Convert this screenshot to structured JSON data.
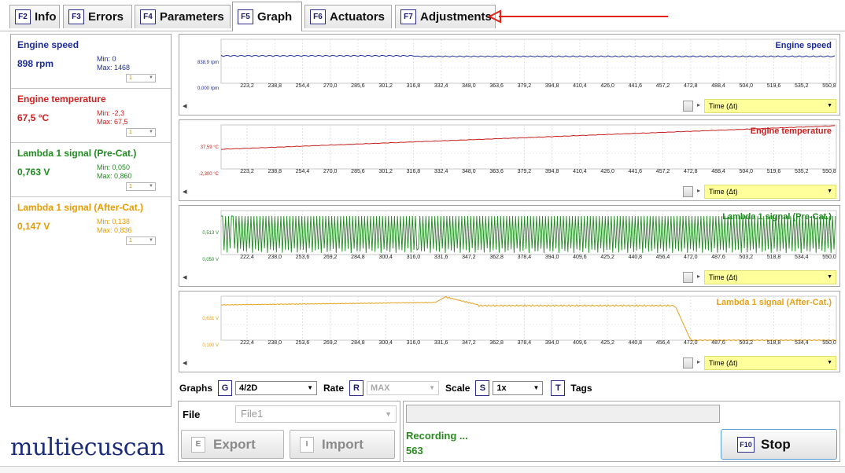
{
  "tabs": [
    {
      "key": "F2",
      "label": "Info"
    },
    {
      "key": "F3",
      "label": "Errors"
    },
    {
      "key": "F4",
      "label": "Parameters"
    },
    {
      "key": "F5",
      "label": "Graph",
      "active": true
    },
    {
      "key": "F6",
      "label": "Actuators"
    },
    {
      "key": "F7",
      "label": "Adjustments"
    }
  ],
  "annotation_arrow_color": "#e2231a",
  "parameters": [
    {
      "name": "Engine speed",
      "value": "898 rpm",
      "min": "Min: 0",
      "max": "Max: 1468",
      "select": "1",
      "color": "#1c2c96"
    },
    {
      "name": "Engine temperature",
      "value": "67,5 °C",
      "min": "Min: -2,3",
      "max": "Max: 67,5",
      "select": "1",
      "color": "#d01f1f"
    },
    {
      "name": "Lambda 1 signal (Pre-Cat.)",
      "value": "0,763 V",
      "min": "Min: 0,050",
      "max": "Max: 0,860",
      "select": "1",
      "color": "#1f8a1f"
    },
    {
      "name": "Lambda 1 signal (After-Cat.)",
      "value": "0,147 V",
      "min": "Min: 0,138",
      "max": "Max: 0,836",
      "select": "1",
      "color": "#e69b00"
    }
  ],
  "graphs": [
    {
      "title": "Engine speed",
      "color": "#1c2c96",
      "ytop": "838,9 rpm",
      "ybot": "0,000 rpm",
      "ticks": [
        "223,2",
        "238,8",
        "254,4",
        "270,0",
        "285,6",
        "301,2",
        "316,8",
        "332,4",
        "348,0",
        "363,6",
        "379,2",
        "394,8",
        "410,4",
        "426,0",
        "441,6",
        "457,2",
        "472,8",
        "488,4",
        "504,0",
        "519,6",
        "535,2",
        "550,8"
      ],
      "time_select": "Time (Δt)"
    },
    {
      "title": "Engine temperature",
      "color": "#c62020",
      "ytop": "37,59 °C",
      "ybot": "-2,300 °C",
      "ticks": [
        "223,2",
        "238,8",
        "254,4",
        "270,0",
        "285,6",
        "301,2",
        "316,8",
        "332,4",
        "348,0",
        "363,6",
        "379,2",
        "394,8",
        "410,4",
        "426,0",
        "441,6",
        "457,2",
        "472,8",
        "488,4",
        "504,0",
        "519,6",
        "535,2",
        "550,8"
      ],
      "time_select": "Time (Δt)"
    },
    {
      "title": "Lambda 1 signal (Pre-Cat.)",
      "color": "#1f8a1f",
      "ytop": "0,513 V",
      "ybot": "0,050 V",
      "ticks": [
        "222,4",
        "238,0",
        "253,6",
        "269,2",
        "284,8",
        "300,4",
        "316,0",
        "331,6",
        "347,2",
        "362,8",
        "378,4",
        "394,0",
        "409,6",
        "425,2",
        "440,8",
        "456,4",
        "472,0",
        "487,6",
        "503,2",
        "518,8",
        "534,4",
        "550,0"
      ],
      "time_select": "Time (Δt)"
    },
    {
      "title": "Lambda 1 signal (After-Cat.)",
      "color": "#e5a21c",
      "ytop": "0,631 V",
      "ybot": "0,100 V",
      "ticks": [
        "222,4",
        "238,0",
        "253,6",
        "269,2",
        "284,8",
        "300,4",
        "316,0",
        "331,6",
        "347,2",
        "362,8",
        "378,4",
        "394,0",
        "409,6",
        "425,2",
        "440,8",
        "456,4",
        "472,0",
        "487,6",
        "503,2",
        "518,8",
        "534,4",
        "550,0"
      ],
      "time_select": "Time (Δt)"
    }
  ],
  "toolbar": {
    "graphs_label": "Graphs",
    "graphs_key": "G",
    "graphs_value": "4/2D",
    "rate_label": "Rate",
    "rate_key": "R",
    "rate_value": "MAX",
    "scale_label": "Scale",
    "scale_key": "S",
    "scale_value": "1x",
    "tags_key": "T",
    "tags_label": "Tags"
  },
  "file": {
    "label": "File",
    "value": "File1",
    "export_key": "E",
    "export_label": "Export",
    "import_key": "I",
    "import_label": "Import"
  },
  "recording": {
    "status": "Recording ...",
    "count": "563",
    "stop_key": "F10",
    "stop_label": "Stop"
  },
  "logo": "multiecuscan"
}
